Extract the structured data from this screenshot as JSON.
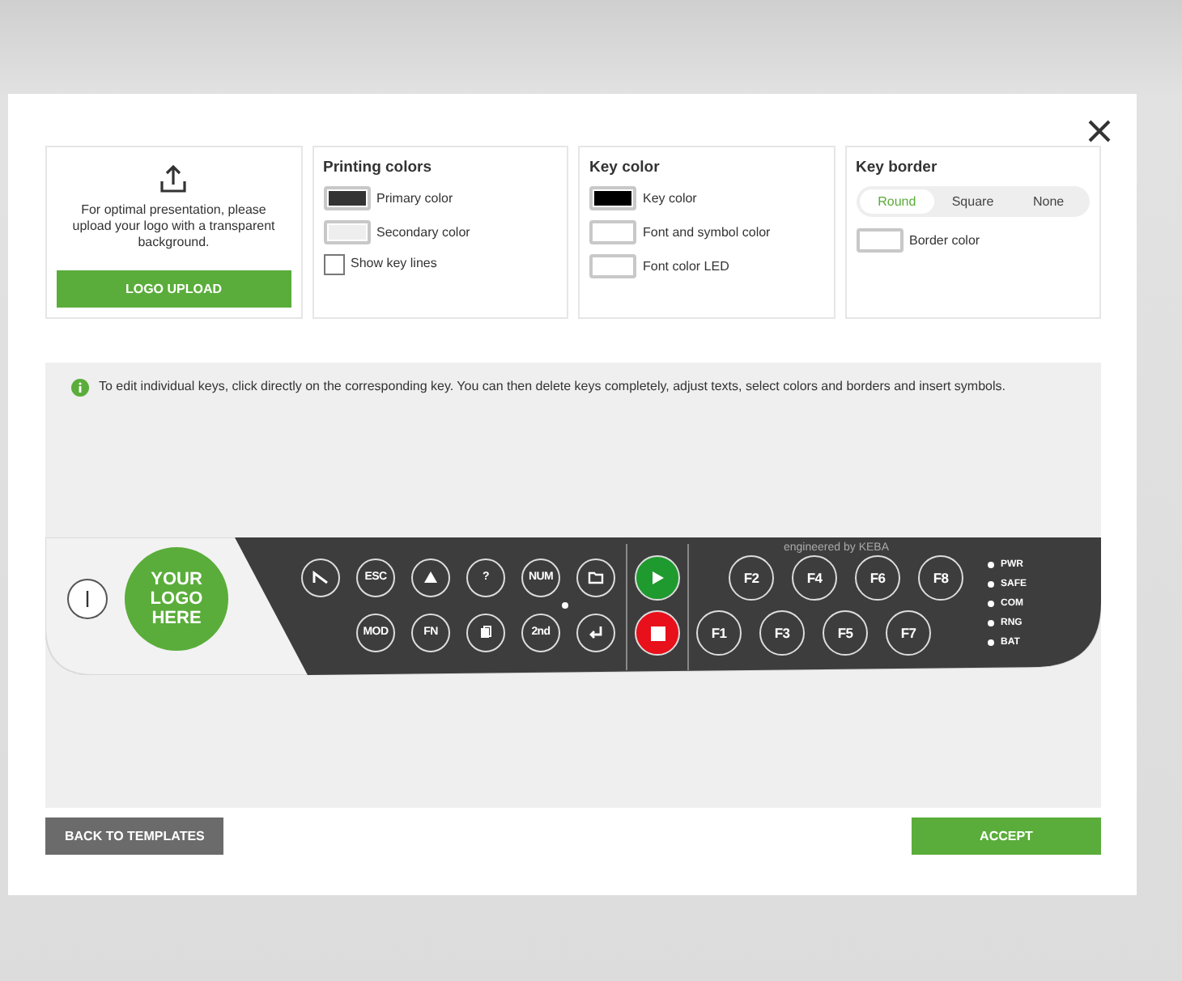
{
  "logo_card": {
    "hint": "For optimal presentation, please upload your logo with a transparent background.",
    "button": "LOGO UPLOAD"
  },
  "printing_colors": {
    "title": "Printing colors",
    "swatches": [
      {
        "label": "Primary color",
        "color": "#333333"
      },
      {
        "label": "Secondary color",
        "color": "#eeeeee"
      }
    ],
    "show_key_lines": {
      "label": "Show key lines",
      "checked": false
    }
  },
  "key_color": {
    "title": "Key color",
    "swatches": [
      {
        "label": "Key color",
        "color": "#000000"
      },
      {
        "label": "Font and symbol color",
        "color": "#ffffff"
      },
      {
        "label": "Font color LED",
        "color": "#ffffff"
      }
    ]
  },
  "key_border": {
    "title": "Key border",
    "options": [
      {
        "label": "Round",
        "selected": true
      },
      {
        "label": "Square",
        "selected": false
      },
      {
        "label": "None",
        "selected": false
      }
    ],
    "swatches": [
      {
        "label": "Border color",
        "color": "#ffffff"
      }
    ]
  },
  "info": "To edit individual keys, click directly on the corresponding key. You can then delete keys completely, adjust texts, select colors and borders and insert symbols.",
  "keypad": {
    "logo_text": "YOUR LOGO HERE",
    "brand": "engineered by KEBA",
    "keys_top": [
      {
        "kind": "mute"
      },
      {
        "kind": "text",
        "label": "ESC"
      },
      {
        "kind": "warning"
      },
      {
        "kind": "text",
        "label": "?"
      },
      {
        "kind": "text",
        "label": "NUM"
      },
      {
        "kind": "folder"
      }
    ],
    "keys_bottom": [
      {
        "kind": "text",
        "label": "MOD"
      },
      {
        "kind": "text",
        "label": "FN"
      },
      {
        "kind": "copy"
      },
      {
        "kind": "text",
        "label": "2nd"
      },
      {
        "kind": "enter"
      }
    ],
    "f_keys_top": [
      "F2",
      "F4",
      "F6",
      "F8"
    ],
    "f_keys_bottom": [
      "F1",
      "F3",
      "F5",
      "F7"
    ],
    "leds": [
      "PWR",
      "SAFE",
      "COM",
      "RNG",
      "BAT"
    ]
  },
  "buttons": {
    "back": "BACK TO TEMPLATES",
    "accept": "ACCEPT"
  }
}
